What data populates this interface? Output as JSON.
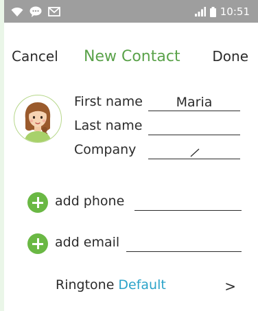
{
  "status_bar": {
    "time": "10:51",
    "icons_left": [
      "wifi-icon",
      "chat-bubble-icon",
      "mail-icon"
    ],
    "icons_right": [
      "signal-icon",
      "battery-icon"
    ],
    "background": "#9e9e9e"
  },
  "nav": {
    "cancel_label": "Cancel",
    "title": "New Contact",
    "done_label": "Done",
    "accent_color": "#5aa24a"
  },
  "avatar": {
    "icon": "avatar-woman-icon"
  },
  "form": {
    "first_name": {
      "label": "First name",
      "value": "Maria"
    },
    "last_name": {
      "label": "Last name",
      "value": ""
    },
    "company": {
      "label": "Company",
      "value": ""
    }
  },
  "add_phone": {
    "label": "add phone",
    "icon": "plus-circle-icon"
  },
  "add_email": {
    "label": "add email",
    "icon": "plus-circle-icon"
  },
  "ringtone": {
    "label": "Ringtone",
    "value": "Default",
    "chevron": ">"
  }
}
